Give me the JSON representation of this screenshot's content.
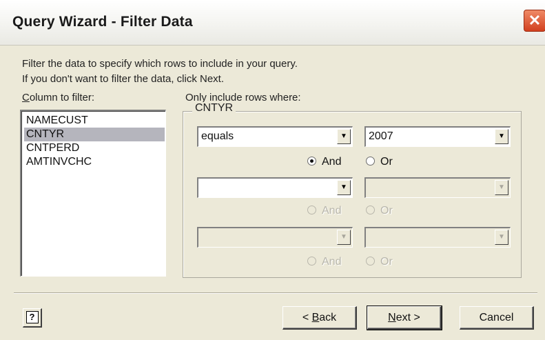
{
  "window": {
    "title": "Query Wizard - Filter Data",
    "close_glyph": "✕"
  },
  "intro": {
    "line1": "Filter the data to specify which rows to include in your query.",
    "line2": "If you don't want to filter the data, click Next."
  },
  "column_list": {
    "label_accel": "C",
    "label_rest": "olumn to filter:",
    "items": [
      "NAMECUST",
      "CNTYR",
      "CNTPERD",
      "AMTINVCHC"
    ],
    "selected": "CNTYR"
  },
  "criteria": {
    "heading": "Only include rows where:",
    "group_label": "CNTYR",
    "rows": [
      {
        "operator": "equals",
        "value": "2007",
        "and_label": "And",
        "or_label": "Or",
        "and_selected": true
      },
      {
        "operator": "",
        "value": "",
        "and_label": "And",
        "or_label": "Or",
        "and_selected": false
      },
      {
        "operator": "",
        "value": "",
        "and_label": "And",
        "or_label": "Or",
        "and_selected": false
      }
    ],
    "arrow_glyph": "▼"
  },
  "buttons": {
    "help_glyph": "?",
    "back_accel": "B",
    "back_rest": "ack",
    "back_prefix": "< ",
    "next_accel": "N",
    "next_rest": "ext",
    "next_suffix": " >",
    "cancel": "Cancel"
  }
}
